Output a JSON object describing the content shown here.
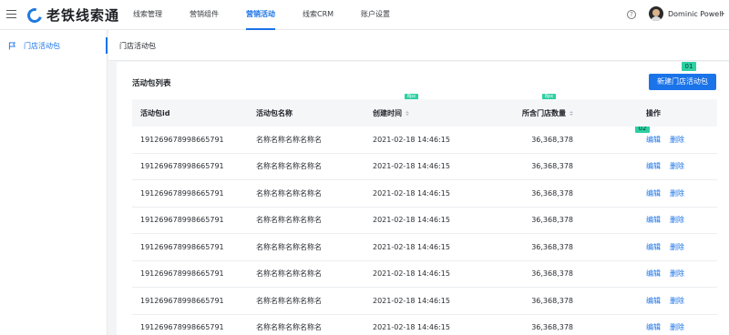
{
  "app": {
    "logo_text": "老铁线索通"
  },
  "nav": {
    "items": [
      "线索管理",
      "营销组件",
      "营销活动",
      "线索CRM",
      "账户设置"
    ],
    "active_index": 2
  },
  "user": {
    "name": "Dominic Powell"
  },
  "sidebar": {
    "items": [
      {
        "label": "门店活动包",
        "icon": "flag-icon"
      }
    ]
  },
  "page": {
    "title": "门店活动包"
  },
  "card": {
    "title": "活动包列表",
    "new_button": "新建门店活动包"
  },
  "annotations": {
    "tag1": "01",
    "tag2": "02",
    "spacing1": "8px",
    "spacing2": "8px"
  },
  "table": {
    "headers": [
      "活动包id",
      "活动包名称",
      "创建时间",
      "所含门店数量",
      "操作"
    ],
    "rows": [
      [
        "191269678998665791",
        "名称名称名称名称名",
        "2021-02-18 14:46:15",
        "36,368,378"
      ],
      [
        "191269678998665791",
        "名称名称名称名称名",
        "2021-02-18 14:46:15",
        "36,368,378"
      ],
      [
        "191269678998665791",
        "名称名称名称名称名",
        "2021-02-18 14:46:15",
        "36,368,378"
      ],
      [
        "191269678998665791",
        "名称名称名称名称名",
        "2021-02-18 14:46:15",
        "36,368,378"
      ],
      [
        "191269678998665791",
        "名称名称名称名称名",
        "2021-02-18 14:46:15",
        "36,368,378"
      ],
      [
        "191269678998665791",
        "名称名称名称名称名",
        "2021-02-18 14:46:15",
        "36,368,378"
      ],
      [
        "191269678998665791",
        "名称名称名称名称名",
        "2021-02-18 14:46:15",
        "36,368,378"
      ],
      [
        "191269678998665791",
        "名称名称名称名称名",
        "2021-02-18 14:46:15",
        "36,368,378"
      ]
    ],
    "actions": {
      "edit": "编辑",
      "delete": "删除"
    }
  },
  "colors": {
    "accent": "#1a73e8",
    "annotation": "#2ed0a3"
  }
}
